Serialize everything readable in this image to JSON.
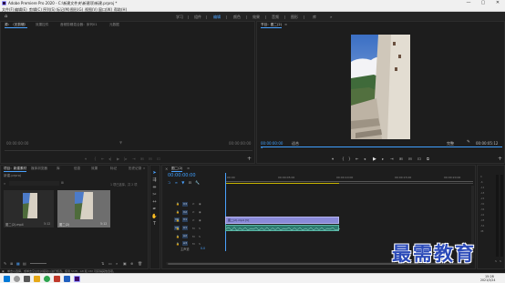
{
  "window": {
    "title": "Adobe Premiere Pro 2020 - C:\\新建文件夹\\新建项\\新建.prproj *",
    "minimize": "—",
    "maximize": "▢",
    "close": "✕"
  },
  "menu": [
    "文件(F)",
    "编辑(E)",
    "剪辑(C)",
    "序列(S)",
    "标记(M)",
    "图形(G)",
    "视图(V)",
    "窗口(W)",
    "帮助(H)"
  ],
  "workspaces": [
    "学习",
    "组件",
    "编辑",
    "颜色",
    "效果",
    "音频",
    "图形",
    "库"
  ],
  "workspace_active_index": 2,
  "workspace_more": "»",
  "source_panel": {
    "tabs": [
      "源：（无剪辑）",
      "效果控件",
      "音频剪辑混合器：序列01",
      "元数据"
    ],
    "active_tab": 0,
    "tc_left": "00:00:00:00",
    "tc_right": "00:00:00:00"
  },
  "program_panel": {
    "tab": "节目：图二(2)",
    "menu_icon": "≡",
    "tc_current": "00:00:00:00",
    "fit": "适合",
    "quality": "完整",
    "tc_duration": "00:00:05:12",
    "wrench": "🔧"
  },
  "project_panel": {
    "tabs": [
      "项目：新建素材",
      "媒体浏览器",
      "库",
      "信息",
      "效果",
      "标记",
      "历史记录"
    ],
    "more": "»",
    "project_file": "新建.prproj",
    "items_count": "1 项已选择，共 2 项",
    "items": [
      {
        "name": "图二(2).mp4",
        "duration": "5:12",
        "selected": false
      },
      {
        "name": "图二(2)",
        "duration": "5:12",
        "selected": true
      }
    ]
  },
  "timeline_panel": {
    "tab": "图二(2)",
    "menu_icon": "≡",
    "timecode": "00:00:00:00",
    "ruler": [
      "00:00",
      "00:00:05:00",
      "00:00:10:00",
      "00:00:15:00",
      "00:00:20:00"
    ],
    "video_tracks": [
      "V3",
      "V2",
      "V1"
    ],
    "audio_tracks": [
      "A1",
      "A2",
      "A3"
    ],
    "master": "主声道",
    "master_val": "0.0",
    "clip_label": "图二(2).mp4 [V]"
  },
  "statusbar": {
    "text": "单击以选择，或单击空白处并拖动以进行框选。使用 Shift、Alt 和 Ctrl 可获得其他选项。"
  },
  "taskbar": {
    "time": "15:28",
    "date": "2021/3/24"
  },
  "watermark": "最需教育",
  "colors": {
    "accent": "#4aa2ff",
    "timecode": "#3fa0ff",
    "clip_video": "#8a8ad8",
    "clip_audio": "#3e9a8a",
    "panel_bg": "#1d1d1d"
  }
}
